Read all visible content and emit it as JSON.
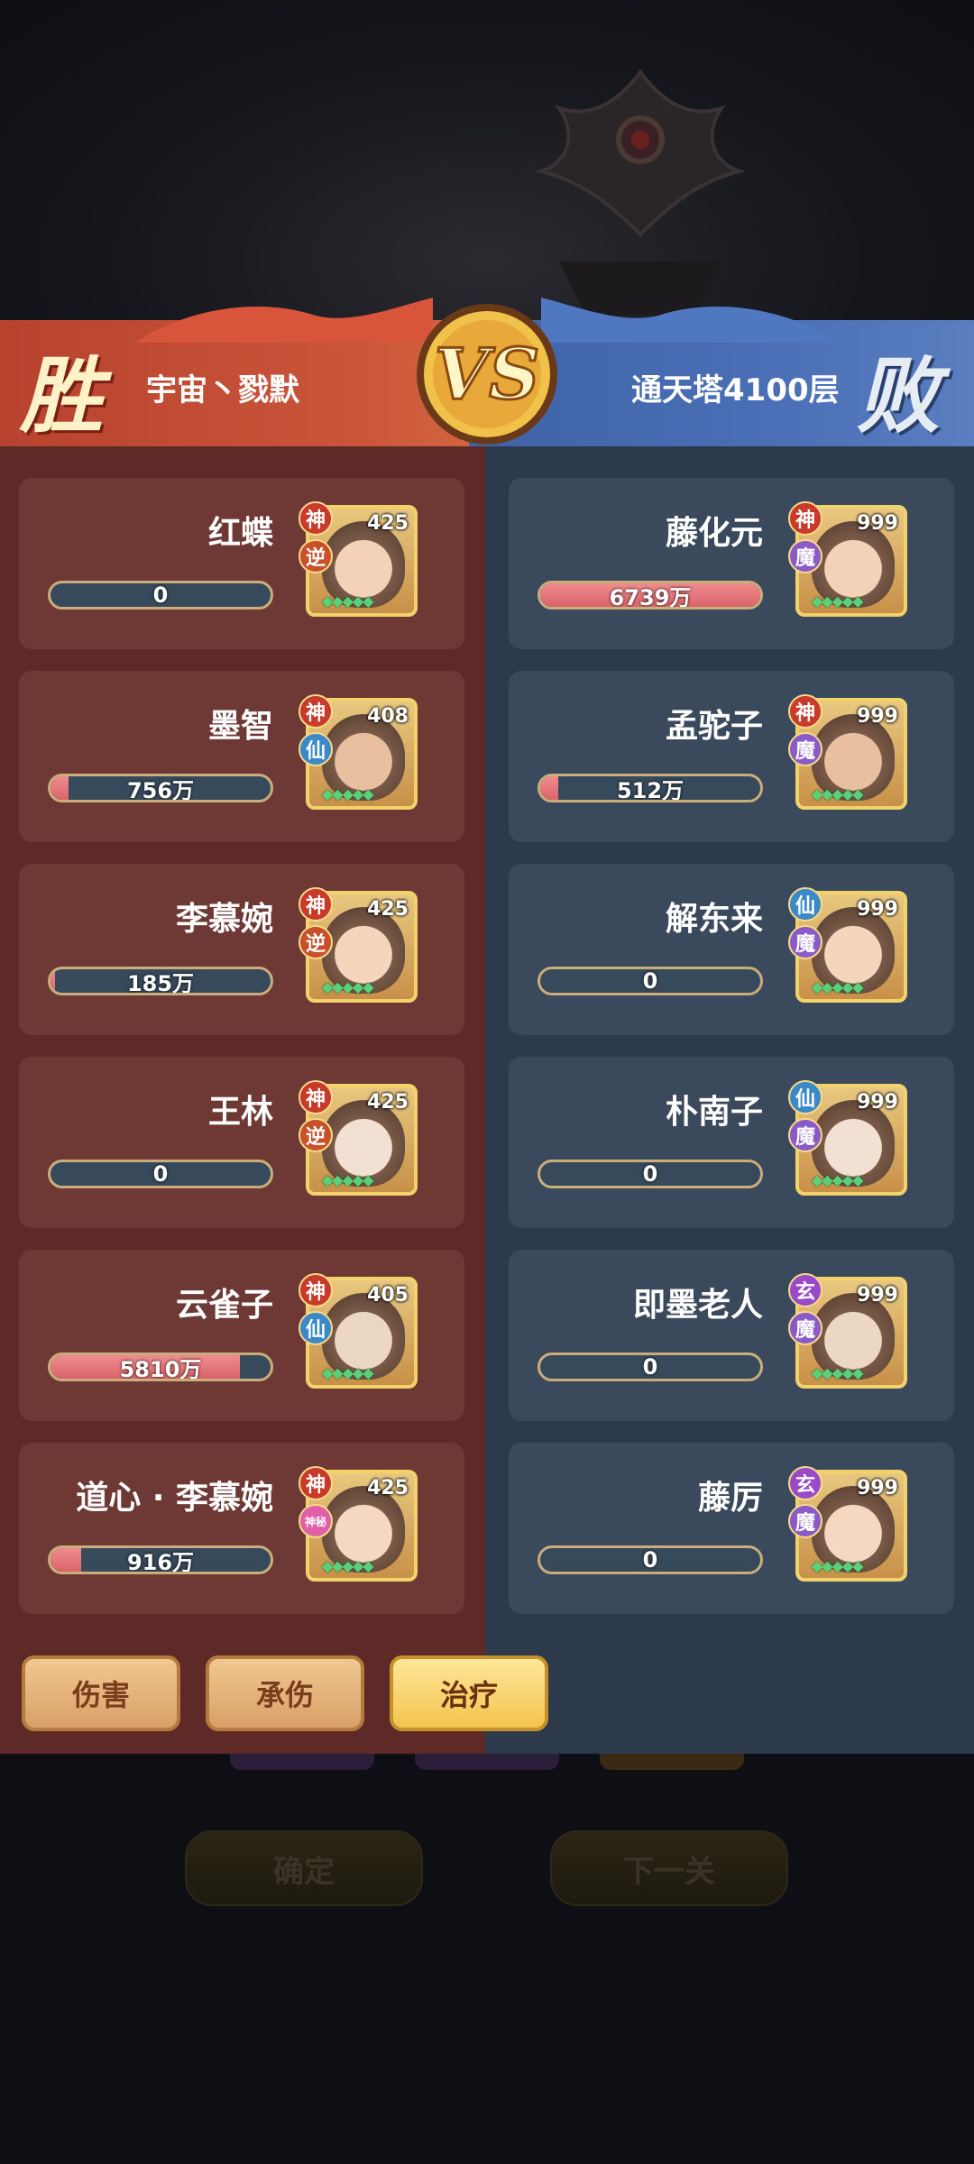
{
  "header": {
    "win_label": "胜",
    "lose_label": "败",
    "left_team": "宇宙丶戮默",
    "right_team": "通天塔4100层",
    "vs_label": "VS"
  },
  "left_heroes": [
    {
      "name": "红蝶",
      "value": "0",
      "fill": 0,
      "level": "425",
      "badge_top": "神",
      "badge_bottom": "逆"
    },
    {
      "name": "墨智",
      "value": "756万",
      "fill": 0.08,
      "level": "408",
      "badge_top": "神",
      "badge_bottom": "仙"
    },
    {
      "name": "李慕婉",
      "value": "185万",
      "fill": 0.02,
      "level": "425",
      "badge_top": "神",
      "badge_bottom": "逆"
    },
    {
      "name": "王林",
      "value": "0",
      "fill": 0,
      "level": "425",
      "badge_top": "神",
      "badge_bottom": "逆"
    },
    {
      "name": "云雀子",
      "value": "5810万",
      "fill": 0.86,
      "level": "405",
      "badge_top": "神",
      "badge_bottom": "仙"
    },
    {
      "name": "道心 · 李慕婉",
      "value": "916万",
      "fill": 0.14,
      "level": "425",
      "badge_top": "神",
      "badge_bottom": "神秘"
    }
  ],
  "right_heroes": [
    {
      "name": "藤化元",
      "value": "6739万",
      "fill": 1.0,
      "level": "999",
      "badge_top": "神",
      "badge_bottom": "魔"
    },
    {
      "name": "孟驼子",
      "value": "512万",
      "fill": 0.08,
      "level": "999",
      "badge_top": "神",
      "badge_bottom": "魔"
    },
    {
      "name": "解东来",
      "value": "0",
      "fill": 0,
      "level": "999",
      "badge_top": "仙",
      "badge_bottom": "魔"
    },
    {
      "name": "朴南子",
      "value": "0",
      "fill": 0,
      "level": "999",
      "badge_top": "仙",
      "badge_bottom": "魔"
    },
    {
      "name": "即墨老人",
      "value": "0",
      "fill": 0,
      "level": "999",
      "badge_top": "玄",
      "badge_bottom": "魔"
    },
    {
      "name": "藤厉",
      "value": "0",
      "fill": 0,
      "level": "999",
      "badge_top": "玄",
      "badge_bottom": "魔"
    }
  ],
  "tabs": {
    "damage": "伤害",
    "taken": "承伤",
    "heal": "治疗"
  },
  "background_buttons": {
    "confirm": "确定",
    "next": "下一关"
  },
  "colors": {
    "win_red": "#c9553a",
    "lose_blue": "#4a6fb6",
    "bar_fill": "#e8767a",
    "frame_gold": "#f2d26a"
  }
}
